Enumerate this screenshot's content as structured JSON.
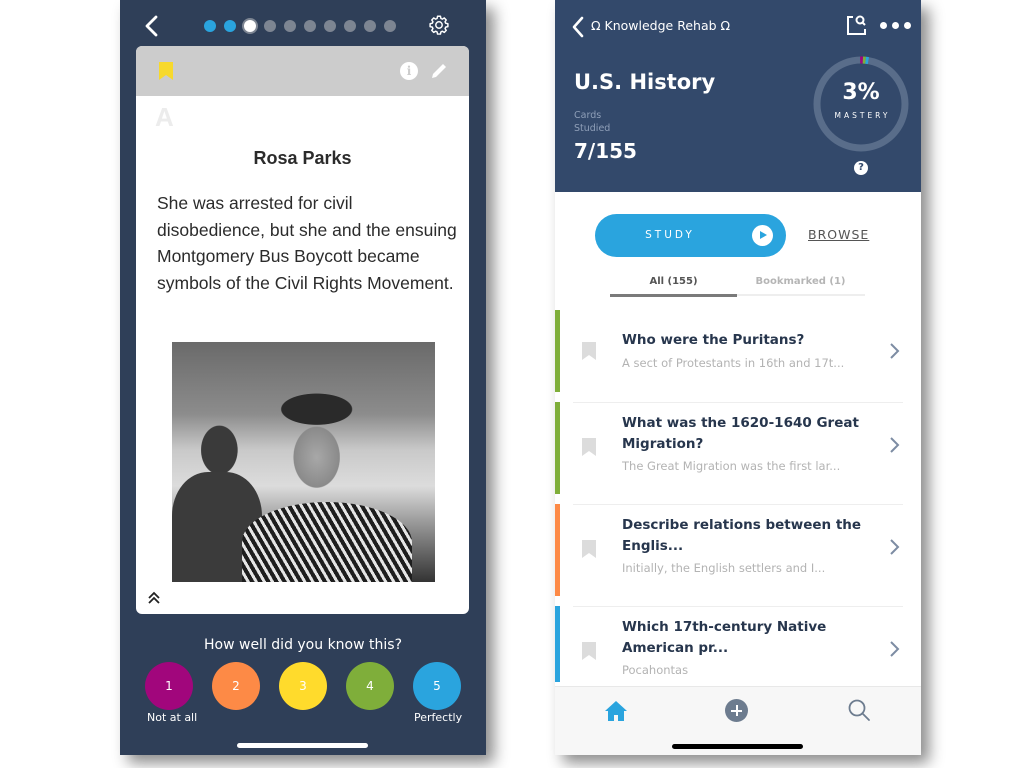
{
  "flashcard_screen": {
    "progress": {
      "total": 10,
      "completed": 2,
      "current_index": 3
    },
    "card": {
      "bookmarked": true,
      "side_label": "A",
      "title": "Rosa Parks",
      "body": "She was arrested for civil disobedience, but she and the ensuing Montgomery Bus Boycott became symbols of the Civil Rights Movement.",
      "image_alt": "Black and white photo of Rosa Parks"
    },
    "rating": {
      "question": "How well did you know this?",
      "options": [
        {
          "label": "1",
          "color": "#a1067c"
        },
        {
          "label": "2",
          "color": "#fd8a46"
        },
        {
          "label": "3",
          "color": "#ffdb2c"
        },
        {
          "label": "4",
          "color": "#7fae3a"
        },
        {
          "label": "5",
          "color": "#2aa4de"
        }
      ],
      "min_label": "Not at all",
      "max_label": "Perfectly"
    }
  },
  "deck_screen": {
    "breadcrumb": "Ω Knowledge Rehab Ω",
    "title": "U.S. History",
    "cards_studied_label": "Cards Studied",
    "cards_studied_value": "7/155",
    "mastery": {
      "percent_text": "3%",
      "label": "MASTERY",
      "value_percent": 3
    },
    "help_label": "?",
    "study_button": "STUDY",
    "browse_link": "BROWSE",
    "tabs": [
      {
        "label": "All (155)",
        "active": true
      },
      {
        "label": "Bookmarked (1)",
        "active": false
      }
    ],
    "cards": [
      {
        "question": "Who were the Puritans?",
        "answer": "A sect of Protestants in 16th and 17t...",
        "color": "#7fae3a"
      },
      {
        "question": "What was the 1620-1640 Great Migration?",
        "answer": "The Great Migration was the first lar...",
        "color": "#7fae3a"
      },
      {
        "question": "Describe relations between the Englis...",
        "answer": "Initially, the English settlers and I...",
        "color": "#fd8a46"
      },
      {
        "question": "Which 17th-century Native American pr...",
        "answer": "Pocahontas",
        "color": "#2aa4de"
      }
    ],
    "tabbar": {
      "items": [
        "home",
        "add",
        "search"
      ],
      "active": "home",
      "accent": "#2aa4de"
    }
  },
  "colors": {
    "left_bg": "#2f3f58",
    "header_bg": "#33496b",
    "accent_blue": "#2aa4de",
    "bookmark_yellow": "#f7d92c"
  }
}
